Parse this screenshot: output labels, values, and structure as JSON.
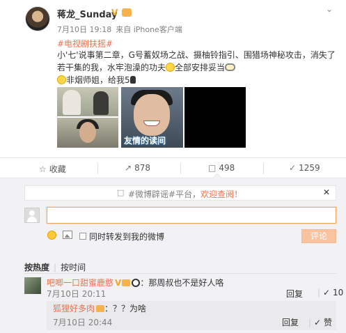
{
  "post": {
    "username": "蒋龙_Sunday",
    "verified_badge": "V",
    "date": "7月10日 19:18",
    "source": "来自 iPhone客户端",
    "hashtag": "#电视剧扶摇#",
    "text": "小'七'说事第二章，G号蓄奴场之战、摄柚铃指引、围猎场神秘攻击，消失了若干集的我，水牢泡澡的功夫",
    "text_end": "全部安排妥当",
    "line2": "非烟师姐，给我5",
    "image_caption": "友情的读间"
  },
  "actions": {
    "favorite_label": "收藏",
    "repost_count": "878",
    "comment_count": "498",
    "like_count": "1259"
  },
  "comment_panel": {
    "notice_prefix": "#微博辟谣#平台，",
    "notice_welcome": "欢迎查阅！",
    "input_value": "",
    "repost_checkbox_label": "同时转发到我的微博",
    "submit_label": "评论",
    "sort_hot": "按热度",
    "sort_time": "按时间"
  },
  "comments": [
    {
      "name": "吧唧一口甜蜜鹿憨",
      "text": "：那周叔也不是好人咯",
      "time": "7月10日 20:11",
      "reply_label": "回复",
      "likes": "10"
    }
  ],
  "sub_comment": {
    "name": "狐狸好多肉",
    "text": "：？？为啥",
    "time": "7月10日 20:44",
    "reply_label": "回复",
    "like_label": "赞"
  },
  "colors": {
    "accent_orange": "#eb7350",
    "panel_bg": "#f2f2f5"
  }
}
